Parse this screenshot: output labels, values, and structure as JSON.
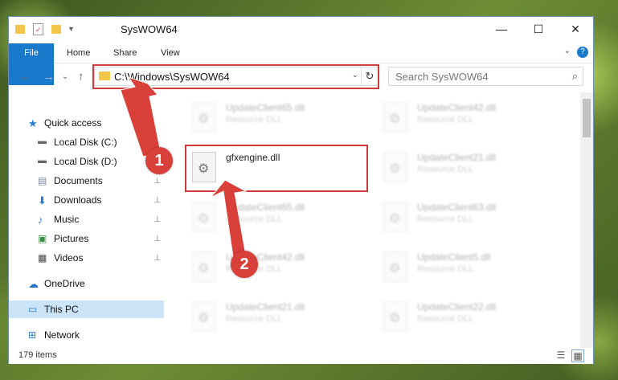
{
  "window": {
    "title": "SysWOW64"
  },
  "titlebar": {
    "minimize": "—",
    "maximize": "☐",
    "close": "✕"
  },
  "ribbon": {
    "tabs": [
      "File",
      "Home",
      "Share",
      "View"
    ],
    "help": "?",
    "collapse": "⌄"
  },
  "navigation": {
    "back": "←",
    "forward": "→",
    "recent": "⌄",
    "up": "↑",
    "address": "C:\\Windows\\SysWOW64",
    "address_dropdown": "⌄",
    "refresh": "↻",
    "search_placeholder": "Search SysWOW64"
  },
  "sidebar": {
    "items": [
      {
        "label": "Quick access",
        "icon": "star-icon",
        "pinned": false
      },
      {
        "label": "Local Disk (C:)",
        "icon": "drive-icon",
        "pinned": true
      },
      {
        "label": "Local Disk (D:)",
        "icon": "drive-icon",
        "pinned": false
      },
      {
        "label": "Documents",
        "icon": "documents-icon",
        "pinned": true
      },
      {
        "label": "Downloads",
        "icon": "download-icon",
        "pinned": true
      },
      {
        "label": "Music",
        "icon": "music-icon",
        "pinned": true
      },
      {
        "label": "Pictures",
        "icon": "pictures-icon",
        "pinned": true
      },
      {
        "label": "Videos",
        "icon": "videos-icon",
        "pinned": true
      },
      {
        "label": "OneDrive",
        "icon": "cloud-icon",
        "pinned": false
      },
      {
        "label": "This PC",
        "icon": "computer-icon",
        "pinned": false,
        "selected": true
      },
      {
        "label": "Network",
        "icon": "network-icon",
        "pinned": false
      }
    ],
    "pin_glyph": "📌"
  },
  "files": [
    {
      "name": "UpdateClient65.dll",
      "desc": "Resource DLL",
      "blurred": true
    },
    {
      "name": "UpdateClient42.dll",
      "desc": "Resource DLL",
      "blurred": true
    },
    {
      "name": "gfxengine.dll",
      "desc": "",
      "blurred": false
    },
    {
      "name": "UpdateClient21.dll",
      "desc": "Resource DLL",
      "blurred": true
    },
    {
      "name": "UpdateClient65.dll",
      "desc": "Resource DLL",
      "blurred": true
    },
    {
      "name": "UpdateClient63.dll",
      "desc": "Resource DLL",
      "blurred": true
    },
    {
      "name": "UpdateClient42.dll",
      "desc": "Resource DLL",
      "blurred": true
    },
    {
      "name": "UpdateClient5.dll",
      "desc": "Resource DLL",
      "blurred": true
    },
    {
      "name": "UpdateClient21.dll",
      "desc": "Resource DLL",
      "blurred": true
    },
    {
      "name": "UpdateClient22.dll",
      "desc": "Resource DLL",
      "blurred": true
    }
  ],
  "status": {
    "count": "179 items"
  },
  "annotations": {
    "step1": "1",
    "step2": "2",
    "color": "#d9403a"
  },
  "colors": {
    "accent": "#1979ca",
    "selection": "#cce4f7",
    "highlight_box": "#d23b3b"
  }
}
